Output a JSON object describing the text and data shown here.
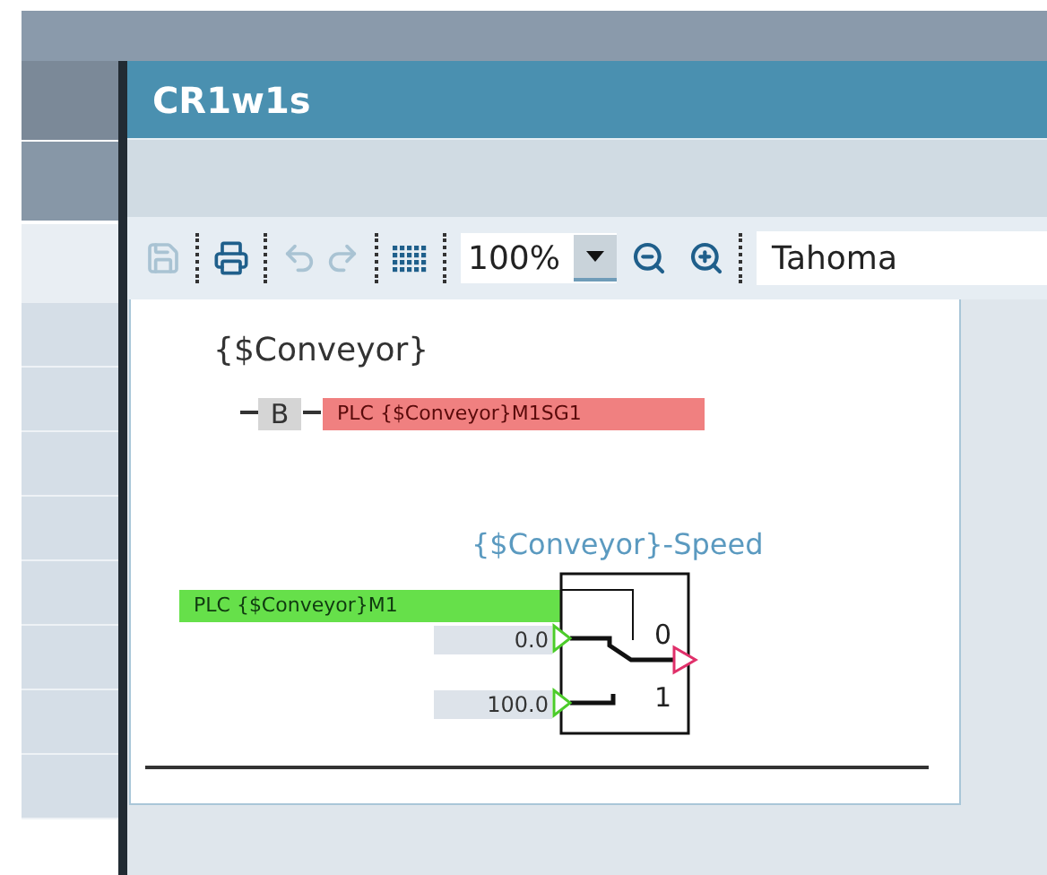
{
  "window": {
    "title": "CR1w1s"
  },
  "toolbar": {
    "items": [
      {
        "kind": "save",
        "disabled": true
      },
      {
        "kind": "print",
        "disabled": false
      },
      {
        "kind": "undo",
        "disabled": true
      },
      {
        "kind": "redo",
        "disabled": true
      },
      {
        "kind": "grid",
        "disabled": false
      }
    ],
    "zoom": "100%",
    "zoom_buttons": [
      {
        "kind": "zoom-out"
      },
      {
        "kind": "zoom-in"
      }
    ],
    "font": "Tahoma"
  },
  "diagram": {
    "title": "{$Conveyor}",
    "contact": {
      "label": "B",
      "tag": "PLC {$Conveyor}M1SG1"
    },
    "block": {
      "title": "{$Conveyor}-Speed",
      "selector": "PLC {$Conveyor}M1",
      "inputs": [
        {
          "value": "0.0",
          "pin": "0"
        },
        {
          "value": "100.0",
          "pin": "1"
        }
      ]
    }
  }
}
